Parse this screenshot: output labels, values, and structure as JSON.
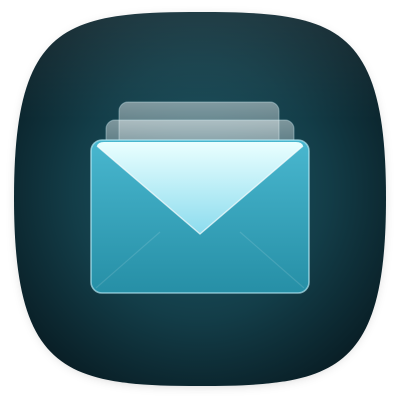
{
  "app_icon": {
    "icon": "mail-icon",
    "colors": {
      "page_background": "#ffffff",
      "tile_center": "#1f5a68",
      "tile_mid": "#133d48",
      "tile_edge": "#081b22",
      "envelope_light": "#eaffff",
      "envelope_flap": "#8cdcee",
      "envelope_body_top": "#49b7cf",
      "envelope_body_bottom": "#268fa6",
      "back_card": "#3b8796"
    }
  }
}
